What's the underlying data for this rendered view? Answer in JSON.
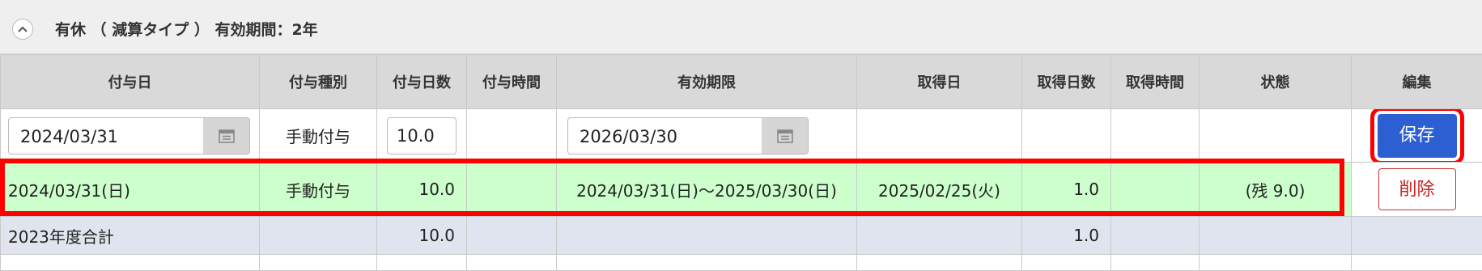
{
  "section": {
    "title": "有休 （ 減算タイプ ） 有効期間：2年",
    "toggle_icon": "chevron-up-icon"
  },
  "columns": [
    "付与日",
    "付与種別",
    "付与日数",
    "付与時間",
    "有効期限",
    "取得日",
    "取得日数",
    "取得時間",
    "状態",
    "編集"
  ],
  "edit_row": {
    "grant_date": "2024/03/31",
    "grant_type": "手動付与",
    "grant_days": "10.0",
    "expiry_date": "2026/03/30",
    "save_label": "保存"
  },
  "grant_row": {
    "grant_date": "2024/03/31(日)",
    "grant_type": "手動付与",
    "grant_days": "10.0",
    "grant_time": "",
    "validity": "2024/03/31(日)～2025/03/30(日)",
    "taken_date": "2025/02/25(火)",
    "taken_days": "1.0",
    "taken_time": "",
    "status": "(残 9.0)",
    "delete_label": "削除"
  },
  "total_row": {
    "label": "2023年度合計",
    "grant_days": "10.0",
    "taken_days": "1.0"
  },
  "colors": {
    "header_bg": "#d9d9d9",
    "grant_row_bg": "#ccffcc",
    "total_row_bg": "#dfe4ee",
    "save_button": "#2b5fd2",
    "highlight": "#ff0000"
  }
}
